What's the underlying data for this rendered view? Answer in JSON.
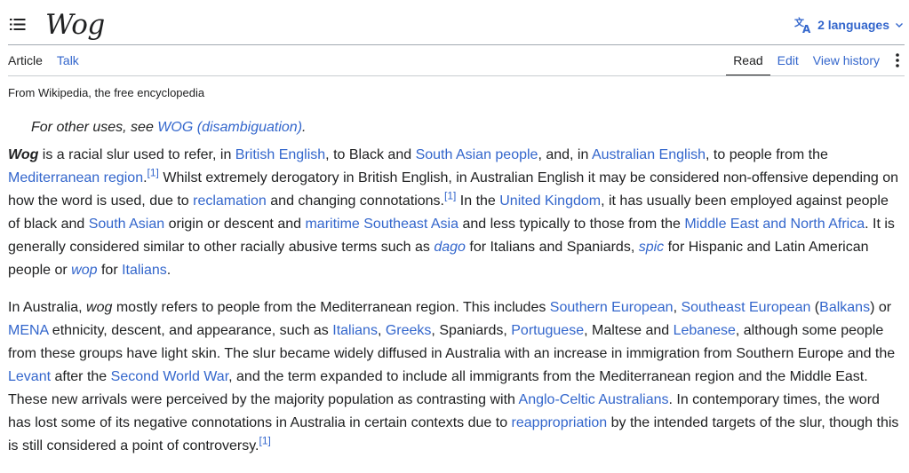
{
  "header": {
    "title": "Wog",
    "languages_label": "2 languages",
    "icons": {
      "menu": "table-of-contents-icon",
      "language": "language-icon",
      "chevron": "chevron-down-icon",
      "more": "more-vertical-icon"
    }
  },
  "tabs": {
    "article": "Article",
    "talk": "Talk",
    "read": "Read",
    "edit": "Edit",
    "history": "View history"
  },
  "tagline": "From Wikipedia, the free encyclopedia",
  "hatnote": {
    "prefix": "For other uses, see ",
    "link": "WOG (disambiguation)",
    "suffix": "."
  },
  "paragraph1": {
    "s1": "Wog",
    "s2": " is a racial slur used to refer, in ",
    "s3": "British English",
    "s4": ", to Black and ",
    "s5": "South Asian people",
    "s6": ", and, in ",
    "s7": "Australian English",
    "s8": ", to people from the ",
    "s9": "Mediterranean region",
    "s10": ".",
    "s11": "[1]",
    "s12": " Whilst extremely derogatory in British English, in Australian English it may be considered non-offensive depending on how the word is used, due to ",
    "s13": "reclamation",
    "s14": " and changing connotations.",
    "s15": "[1]",
    "s16": " In the ",
    "s17": "United Kingdom",
    "s18": ", it has usually been employed against people of black and ",
    "s19": "South Asian",
    "s20": " origin or descent and ",
    "s21": "maritime Southeast Asia",
    "s22": " and less typically to those from the ",
    "s23": "Middle East and North Africa",
    "s24": ". It is generally considered similar to other racially abusive terms such as ",
    "s25": "dago",
    "s26": " for Italians and Spaniards, ",
    "s27": "spic",
    "s28": " for Hispanic and Latin American people or ",
    "s29": "wop",
    "s30": " for ",
    "s31": "Italians",
    "s32": "."
  },
  "paragraph2": {
    "s1": "In Australia, ",
    "s2": "wog",
    "s3": " mostly refers to people from the Mediterranean region. This includes ",
    "s4": "Southern European",
    "s5": ", ",
    "s6": "Southeast European",
    "s7": " (",
    "s8": "Balkans",
    "s9": ") or ",
    "s10": "MENA",
    "s11": " ethnicity, descent, and appearance, such as ",
    "s12": "Italians",
    "s13": ", ",
    "s14": "Greeks",
    "s15": ", Spaniards, ",
    "s16": "Portuguese",
    "s17": ", Maltese and ",
    "s18": "Lebanese",
    "s19": ", although some people from these groups have light skin. The slur became widely diffused in Australia with an increase in immigration from Southern Europe and the ",
    "s20": "Levant",
    "s21": " after the ",
    "s22": "Second World War",
    "s23": ", and the term expanded to include all immigrants from the Mediterranean region and the Middle East. These new arrivals were perceived by the majority population as contrasting with ",
    "s24": "Anglo-Celtic Australians",
    "s25": ". In contemporary times, the word has lost some of its negative connotations in Australia in certain contexts due to ",
    "s26": "reappropriation",
    "s27": " by the intended targets of the slur, though this is still considered a point of controversy.",
    "s28": "[1]"
  },
  "colors": {
    "link": "#3366cc",
    "text": "#202122",
    "rule": "#a2a9b1"
  }
}
